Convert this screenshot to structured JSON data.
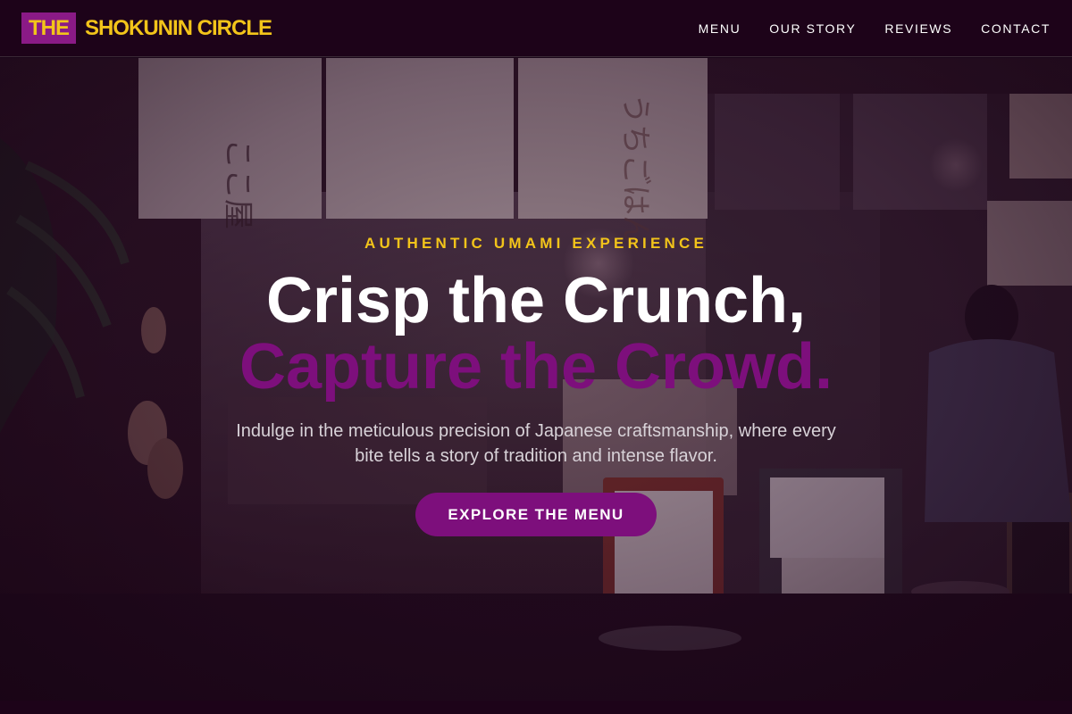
{
  "header": {
    "logo_box": "THE",
    "logo_text": "SHOKUNIN CIRCLE",
    "nav": [
      "MENU",
      "OUR STORY",
      "REVIEWS",
      "CONTACT"
    ]
  },
  "hero": {
    "eyebrow": "AUTHENTIC UMAMI EXPERIENCE",
    "title_line1": "Crisp the Crunch,",
    "title_line2": "Capture the Crowd.",
    "lead": "Indulge in the meticulous precision of Japanese craftsmanship, where every bite tells a story of tradition and intense flavor.",
    "cta": "EXPLORE THE MENU"
  },
  "colors": {
    "brand_purple": "#7d0f7c",
    "brand_gold": "#f2c41a",
    "header_bg": "#1d0319"
  }
}
